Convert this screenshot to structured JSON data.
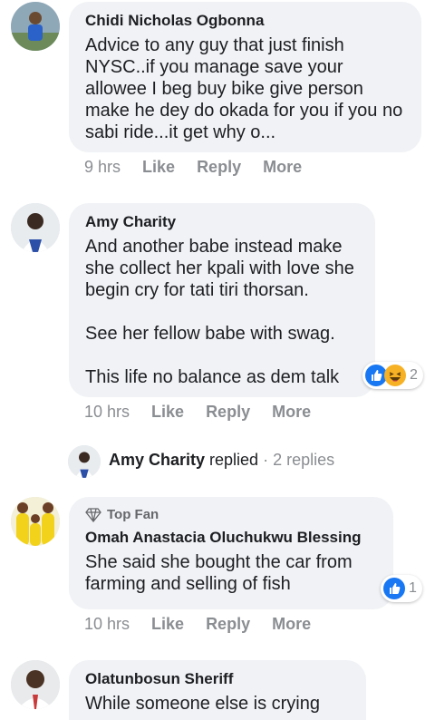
{
  "comments": [
    {
      "author": "Chidi Nicholas Ogbonna",
      "text": "Advice to any guy that just finish NYSC..if you manage save your allowee I beg buy bike give person make he dey do okada for you if you no sabi ride...it get why o...",
      "time": "9 hrs",
      "like": "Like",
      "reply": "Reply",
      "more": "More"
    },
    {
      "author": "Amy Charity",
      "text": "And another babe instead make she collect her kpali with love she begin cry for tati tiri thorsan.\n\nSee her fellow babe with swag.\n\nThis life no balance as dem talk",
      "time": "10 hrs",
      "like": "Like",
      "reply": "Reply",
      "more": "More",
      "reactions": {
        "icons": [
          "like-icon",
          "haha-icon"
        ],
        "count": "2"
      },
      "replies": {
        "name": "Amy Charity",
        "verb": "replied",
        "count": "· 2 replies"
      }
    },
    {
      "badge": "Top Fan",
      "author": "Omah Anastacia Oluchukwu Blessing",
      "text": "She said she bought the car from farming and selling of fish",
      "time": "10 hrs",
      "like": "Like",
      "reply": "Reply",
      "more": "More",
      "reactions": {
        "icons": [
          "like-icon"
        ],
        "count": "1"
      }
    },
    {
      "author": "Olatunbosun Sheriff",
      "text": "While someone else is crying"
    }
  ],
  "colors": {
    "bubble": "#f0f2f5",
    "meta": "#8a8d91",
    "like": "#1877f2",
    "haha": "#f7b125"
  }
}
